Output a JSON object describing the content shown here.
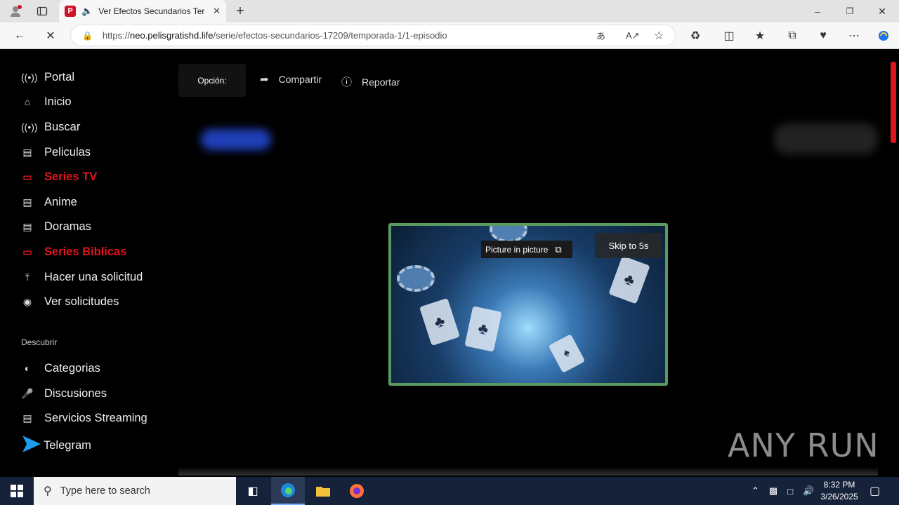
{
  "browser": {
    "tab_title": "Ver Efectos Secundarios Ter",
    "tab_favicon_letter": "P",
    "url_scheme": "https://",
    "url_host": "neo.pelisgratishd.life",
    "url_path": "/serie/efectos-secundarios-17209/temporada-1/1-episodio"
  },
  "sidebar": {
    "items": [
      {
        "label": "Portal",
        "icon": "broadcast-icon"
      },
      {
        "label": "Inicio",
        "icon": "home-icon"
      },
      {
        "label": "Buscar",
        "icon": "broadcast-icon"
      },
      {
        "label": "Peliculas",
        "icon": "film-icon"
      },
      {
        "label": "Series TV",
        "icon": "tv-icon",
        "active": true
      },
      {
        "label": "Anime",
        "icon": "film-icon"
      },
      {
        "label": "Doramas",
        "icon": "film-icon"
      },
      {
        "label": "Series Biblicas",
        "icon": "tv-icon",
        "active": true
      },
      {
        "label": "Hacer una solicitud",
        "icon": "upload-icon"
      },
      {
        "label": "Ver solicitudes",
        "icon": "eye-icon"
      }
    ],
    "section_label": "Descubrir",
    "discover": [
      {
        "label": "Categorias",
        "icon": "half-circle-icon"
      },
      {
        "label": "Discusiones",
        "icon": "microphone-icon"
      },
      {
        "label": "Servicios Streaming",
        "icon": "stack-icon"
      },
      {
        "label": "Telegram",
        "icon": "telegram-icon"
      }
    ]
  },
  "toolbar": {
    "option_label": "Opción:",
    "share_label": "Compartir",
    "report_label": "Reportar"
  },
  "player": {
    "pip_label": "Picture in picture",
    "skip_label": "Skip to 5s"
  },
  "watermark": "ANY RUN",
  "taskbar": {
    "search_placeholder": "Type here to search",
    "time": "8:32 PM",
    "date": "3/26/2025"
  },
  "colors": {
    "accent_red": "#e0141c",
    "player_border": "#5a9a5f",
    "taskbar": "#16213a"
  }
}
